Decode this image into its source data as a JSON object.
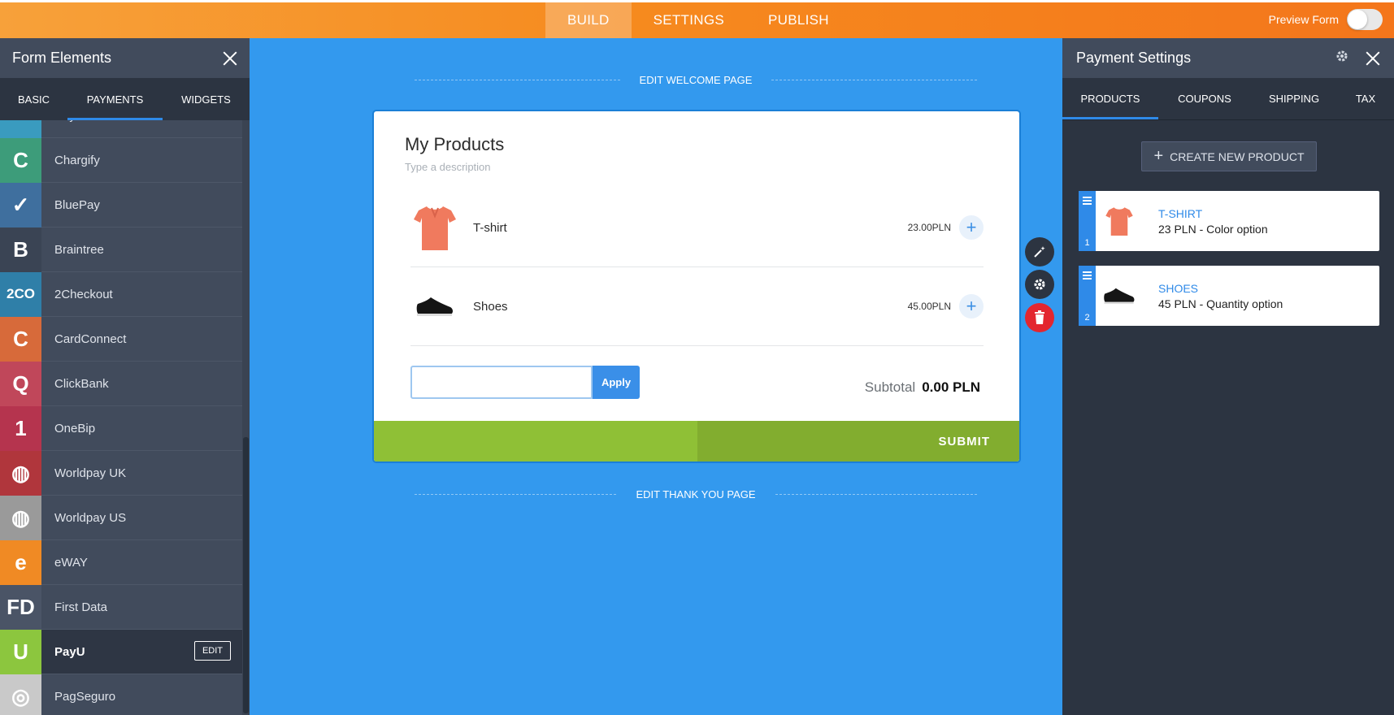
{
  "topbar": {
    "tabs": [
      {
        "label": "BUILD",
        "active": true
      },
      {
        "label": "SETTINGS",
        "active": false
      },
      {
        "label": "PUBLISH",
        "active": false
      }
    ],
    "preview_label": "Preview Form"
  },
  "left_panel": {
    "title": "Form Elements",
    "tabs": [
      {
        "label": "BASIC"
      },
      {
        "label": "PAYMENTS",
        "active": true
      },
      {
        "label": "WIDGETS"
      }
    ],
    "items": [
      {
        "label": "Paysunction",
        "icon": "paysunction-icon",
        "glyph": "~",
        "color": "#3a9bbf"
      },
      {
        "label": "Chargify",
        "icon": "chargify-icon",
        "glyph": "C",
        "color": "#3d9c7a"
      },
      {
        "label": "BluePay",
        "icon": "bluepay-icon",
        "glyph": "✓",
        "color": "#3f6f9e"
      },
      {
        "label": "Braintree",
        "icon": "braintree-icon",
        "glyph": "B",
        "color": "#3a4454"
      },
      {
        "label": "2Checkout",
        "icon": "2checkout-icon",
        "glyph": "2CO",
        "color": "#2f7fa8"
      },
      {
        "label": "CardConnect",
        "icon": "cardconnect-icon",
        "glyph": "C",
        "color": "#d76a3a"
      },
      {
        "label": "ClickBank",
        "icon": "clickbank-icon",
        "glyph": "Q",
        "color": "#c0475a"
      },
      {
        "label": "OneBip",
        "icon": "onebip-icon",
        "glyph": "1",
        "color": "#b5344e"
      },
      {
        "label": "Worldpay UK",
        "icon": "worldpay-uk-icon",
        "glyph": "◍",
        "color": "#b0363c"
      },
      {
        "label": "Worldpay US",
        "icon": "worldpay-us-icon",
        "glyph": "◍",
        "color": "#9a9a9a"
      },
      {
        "label": "eWAY",
        "icon": "eway-icon",
        "glyph": "e",
        "color": "#f08a24"
      },
      {
        "label": "First Data",
        "icon": "first-data-icon",
        "glyph": "FD",
        "color": "#4a5466"
      },
      {
        "label": "PayU",
        "icon": "payu-icon",
        "glyph": "U",
        "color": "#8cc63e",
        "active": true,
        "edit_label": "EDIT"
      },
      {
        "label": "PagSeguro",
        "icon": "pagseguro-icon",
        "glyph": "◎",
        "color": "#c9c9c9"
      }
    ]
  },
  "canvas": {
    "welcome_label": "EDIT WELCOME PAGE",
    "thankyou_label": "EDIT THANK YOU PAGE",
    "form": {
      "title": "My Products",
      "description": "Type a description",
      "products": [
        {
          "name": "T-shirt",
          "price": "23.00PLN",
          "icon": "tshirt-icon"
        },
        {
          "name": "Shoes",
          "price": "45.00PLN",
          "icon": "shoe-icon"
        }
      ],
      "coupon_placeholder": "",
      "apply_label": "Apply",
      "subtotal_label": "Subtotal",
      "subtotal_value": "0.00 PLN",
      "submit_label": "SUBMIT"
    }
  },
  "right_panel": {
    "title": "Payment Settings",
    "tabs": [
      {
        "label": "PRODUCTS",
        "active": true
      },
      {
        "label": "COUPONS"
      },
      {
        "label": "SHIPPING"
      },
      {
        "label": "TAX"
      }
    ],
    "create_label": "CREATE NEW PRODUCT",
    "products": [
      {
        "num": "1",
        "name": "T-SHIRT",
        "desc": "23 PLN - Color option",
        "icon": "tshirt-icon"
      },
      {
        "num": "2",
        "name": "SHOES",
        "desc": "45 PLN - Quantity option",
        "icon": "shoe-icon"
      }
    ]
  },
  "colors": {
    "accent_blue": "#2f8ae8",
    "topbar_orange": "#f68a1e",
    "submit_green": "#8fc036",
    "delete_red": "#e3262f"
  }
}
